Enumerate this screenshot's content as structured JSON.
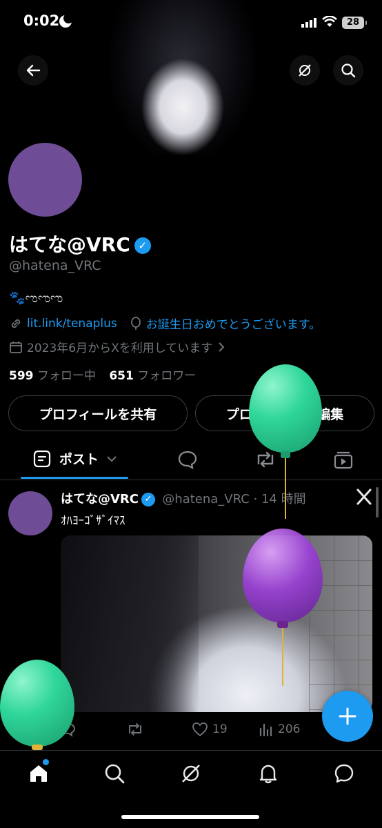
{
  "status": {
    "time": "0:02",
    "battery": "28"
  },
  "profile": {
    "name": "はてな@VRC",
    "handle": "@hatena_VRC",
    "bio": "🐾ಌಌಌ",
    "link": "lit.link/tenaplus",
    "birthday": "お誕生日おめでとうございます。",
    "joined": "2023年6月からXを利用しています",
    "following_count": "599",
    "following_label": "フォロー中",
    "followers_count": "651",
    "followers_label": "フォロワー",
    "share_button": "プロフィールを共有",
    "edit_button": "プロフィールを編集"
  },
  "tabs": {
    "posts": "ポスト"
  },
  "post": {
    "name": "はてな@VRC",
    "meta": "@hatena_VRC · 14 時間",
    "text": "ｵﾊﾖｰｺﾞｻﾞｲﾏｽ",
    "likes": "19",
    "views": "206"
  },
  "colors": {
    "accent": "#1d9bf0",
    "avatar": "#6e4d96",
    "balloon_green": "#2fd69a",
    "balloon_purple": "#9a3fd6"
  },
  "icons": [
    "back-arrow-icon",
    "grok-icon",
    "search-icon",
    "verified-icon",
    "link-icon",
    "balloon-icon",
    "calendar-icon",
    "chevron-right-icon",
    "posts-icon",
    "chevron-down-icon",
    "replies-icon",
    "retweet-icon",
    "video-icon",
    "x-logo-icon",
    "like-icon",
    "views-icon",
    "plus-icon",
    "home-icon",
    "notifications-icon",
    "messages-icon"
  ]
}
